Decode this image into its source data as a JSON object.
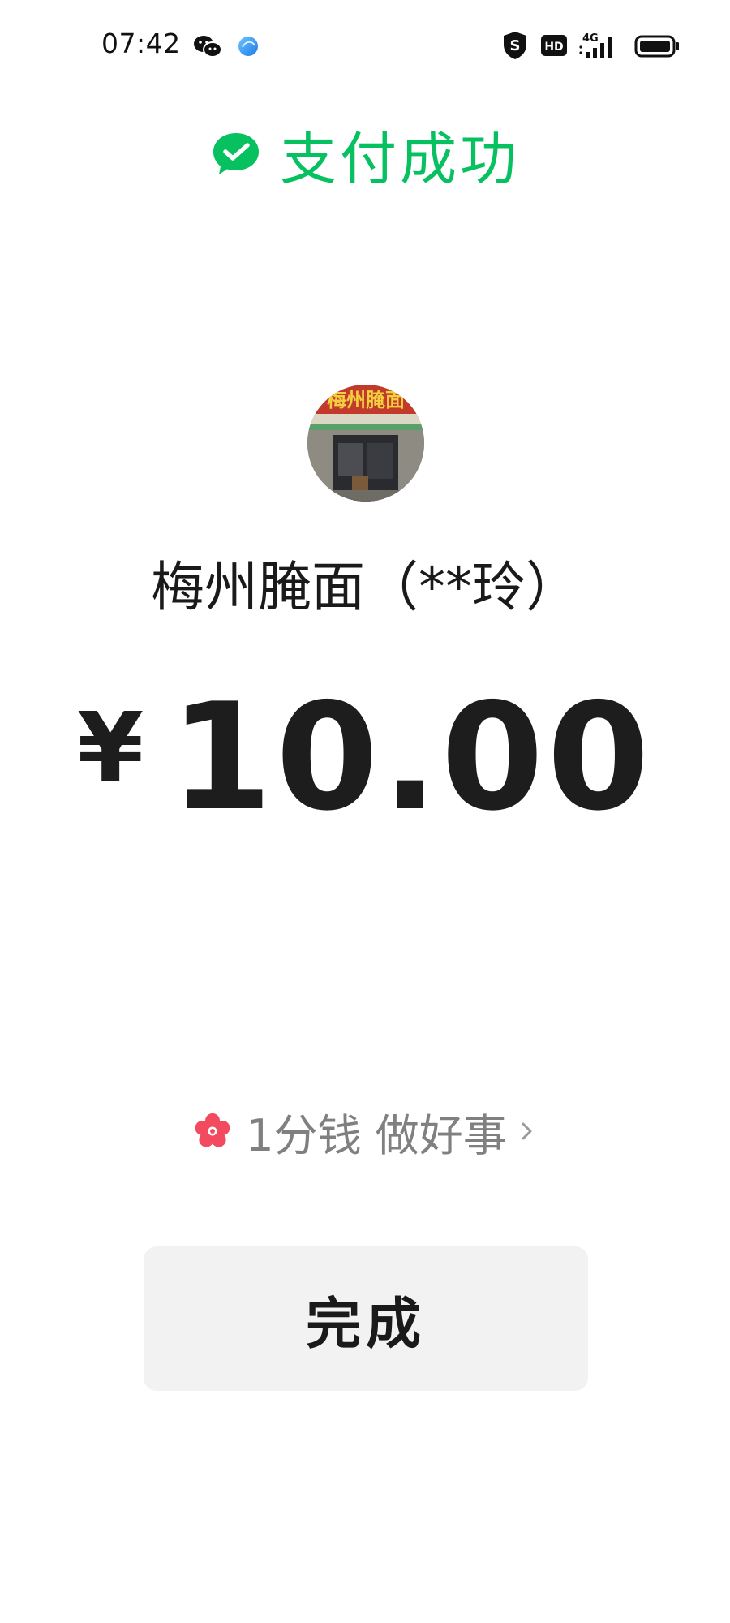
{
  "status_bar": {
    "time": "07:42",
    "network": "4G",
    "hd_label": "HD",
    "icons": [
      "wechat-icon",
      "app-notification-icon",
      "shield-icon",
      "hd-icon",
      "signal-icon",
      "battery-icon"
    ]
  },
  "header": {
    "title": "支付成功",
    "icon": "checkmark-bubble-icon",
    "accent_color": "#07c160"
  },
  "merchant": {
    "name": "梅州腌面（**玲）",
    "avatar_sign_text": "梅州腌面"
  },
  "payment": {
    "currency_symbol": "¥",
    "amount": "10.00"
  },
  "charity": {
    "label": "1分钱 做好事",
    "icon": "flower-icon",
    "icon_color": "#f24a5e"
  },
  "actions": {
    "done_label": "完成"
  }
}
